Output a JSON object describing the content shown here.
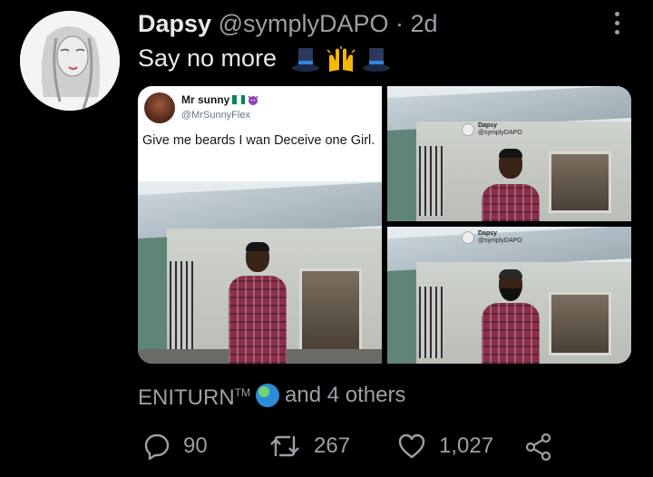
{
  "tweet": {
    "author_name": "Dapsy",
    "author_handle": "@symplyDAPO",
    "separator": "·",
    "time": "2d",
    "text": "Say no more",
    "emojis": [
      "top-hat-icon",
      "raising-hands-icon",
      "top-hat-icon"
    ]
  },
  "quoted_tweet": {
    "name": "Mr sunny",
    "name_badges": [
      "nigeria-flag-icon",
      "purple-devil-icon"
    ],
    "handle": "@MrSunnyFlex",
    "text": "Give me beards I wan Deceive one Girl."
  },
  "watermark": {
    "name": "Dapsy",
    "handle": "@symplyDAPO"
  },
  "likers": {
    "first": "ENITURN",
    "trademark": "TM",
    "rest": "and 4 others"
  },
  "actions": {
    "replies": "90",
    "retweets": "267",
    "likes": "1,027"
  },
  "colors": {
    "background": "#000000",
    "text": "#e7e9ea",
    "muted": "#9aa0a6"
  }
}
